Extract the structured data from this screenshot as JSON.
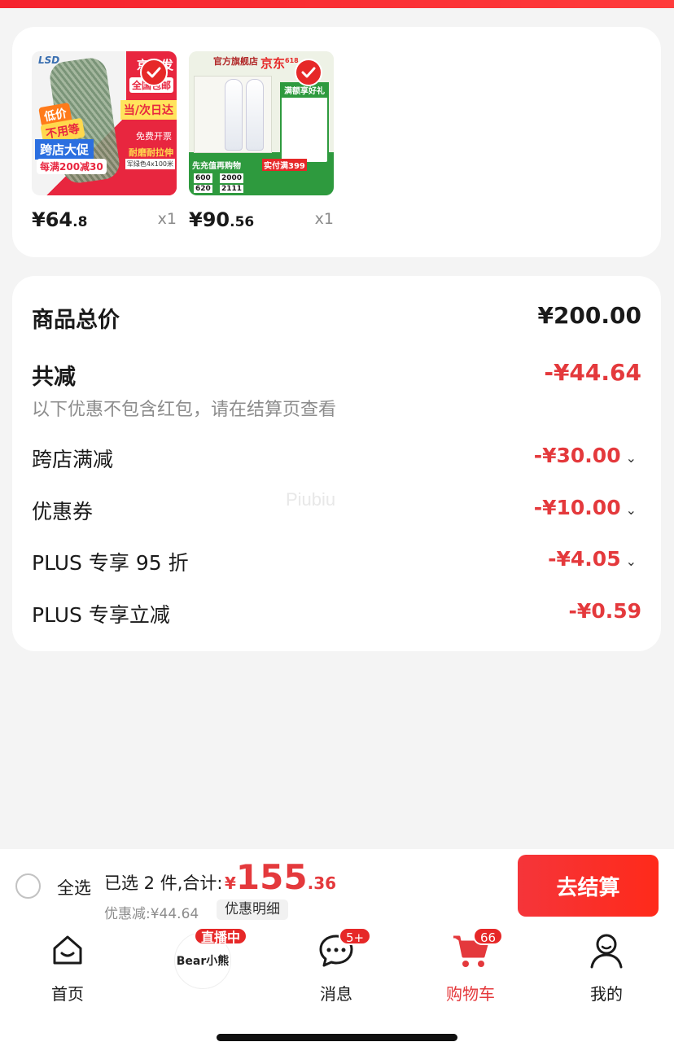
{
  "products": [
    {
      "price_main": "¥64",
      "price_dec": ".8",
      "qty": "x1",
      "thumb_texts": {
        "brand": "LSD",
        "top": "京东发",
        "region": "全国包邮",
        "speed": "当/次日达",
        "promo1": "低价",
        "promo2": "不用等",
        "cross": "跨店大促",
        "deal": "每满200减30",
        "invoice": "免费开票",
        "wear": "耐磨耐拉伸",
        "color": "军绿色4x100米"
      }
    },
    {
      "price_main": "¥90",
      "price_dec": ".56",
      "qty": "x1",
      "thumb_texts": {
        "store": "官方旗舰店",
        "jd": "京东",
        "jd_sup": "618",
        "gift": "满额享好礼",
        "extra": "先充值再购物",
        "deal": "实付满399",
        "n1": "600",
        "n2": "2000",
        "n3": "620",
        "n4": "2111"
      }
    }
  ],
  "summary": {
    "total_label": "商品总价",
    "total_value": "¥200.00",
    "reduce_label": "共减",
    "reduce_value": "-¥44.64",
    "note": "以下优惠不包含红包，请在结算页查看",
    "items": [
      {
        "label": "跨店满减",
        "value": "-¥30.00",
        "chev": "⌄"
      },
      {
        "label": "优惠券",
        "value": "-¥10.00",
        "chev": "⌄"
      },
      {
        "label": "PLUS 专享 95 折",
        "value": "-¥4.05",
        "chev": "⌄"
      },
      {
        "label": "PLUS 专享立减",
        "value": "-¥0.59",
        "chev": ""
      }
    ],
    "watermark": "Piubiu"
  },
  "bottom": {
    "select_all": "全选",
    "selected": "已选 2 件,合计:",
    "yen": "¥",
    "total_big": "155",
    "total_dec": ".36",
    "discount": "优惠减:¥44.64",
    "detail": "优惠明细",
    "checkout": "去结算"
  },
  "tabs": [
    {
      "label": "首页",
      "icon": "home-icon"
    },
    {
      "label": "",
      "icon": "live-avatar",
      "badge": "直播中",
      "avatar_text": "Bear小熊"
    },
    {
      "label": "消息",
      "icon": "message-icon",
      "badge": "5+"
    },
    {
      "label": "购物车",
      "icon": "cart-icon",
      "badge": "66",
      "active": true
    },
    {
      "label": "我的",
      "icon": "profile-icon"
    }
  ],
  "colors": {
    "accent": "#e4393c",
    "checkout": "#f5353a"
  }
}
